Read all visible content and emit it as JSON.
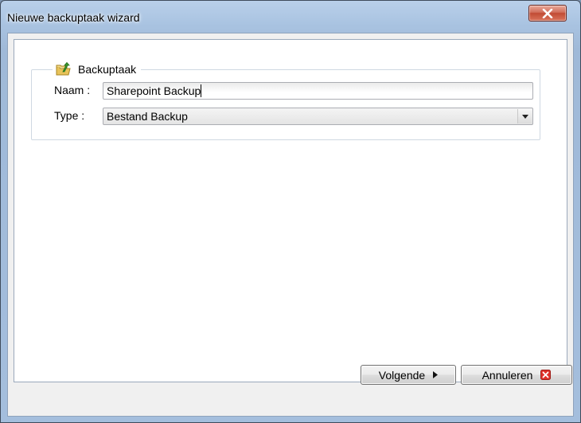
{
  "window": {
    "title": "Nieuwe backuptaak wizard"
  },
  "group": {
    "legend": "Backuptaak",
    "icon": "folder-backup-icon"
  },
  "form": {
    "name_label": "Naam :",
    "name_value": "Sharepoint Backup",
    "type_label": "Type :",
    "type_value": "Bestand Backup"
  },
  "buttons": {
    "next_label": "Volgende",
    "cancel_label": "Annuleren"
  },
  "colors": {
    "close_red": "#c8482f",
    "cancel_icon_red": "#e0322b",
    "folder_yellow": "#e8c35a",
    "arrow_green": "#3b9b2f"
  }
}
